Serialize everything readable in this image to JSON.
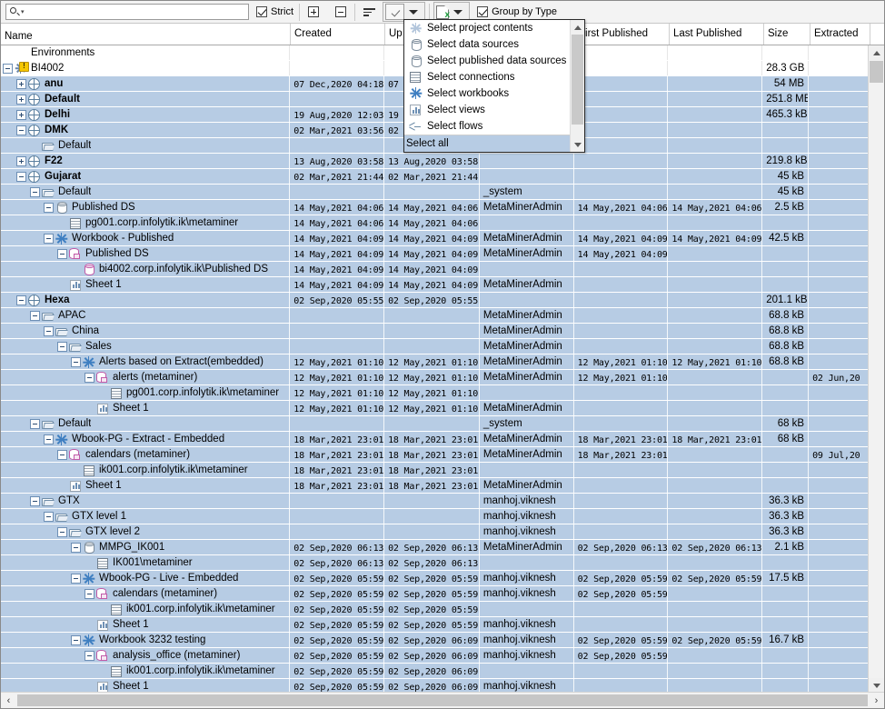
{
  "toolbar": {
    "search_placeholder": "",
    "search_value": "",
    "strict_label": "Strict",
    "strict_checked": true,
    "expand_all_title": "Expand all",
    "collapse_all_title": "Collapse all",
    "sort_title": "Sort",
    "select_combo_title": "Selection",
    "export_title": "Export",
    "group_by_type_label": "Group by Type",
    "group_by_type_checked": true
  },
  "menu": {
    "items": [
      {
        "label": "Select project contents",
        "icon": "project-contents-icon"
      },
      {
        "label": "Select data sources",
        "icon": "data-source-icon"
      },
      {
        "label": "Select published data sources",
        "icon": "published-data-source-icon"
      },
      {
        "label": "Select connections",
        "icon": "connection-icon"
      },
      {
        "label": "Select workbooks",
        "icon": "workbook-icon"
      },
      {
        "label": "Select views",
        "icon": "view-icon"
      },
      {
        "label": "Select flows",
        "icon": "flow-icon"
      }
    ],
    "footer": {
      "label": "Select all",
      "selected": true
    }
  },
  "grid": {
    "columns": [
      {
        "key": "name",
        "label": "Name"
      },
      {
        "key": "created",
        "label": "Created"
      },
      {
        "key": "updated",
        "label": "Up"
      },
      {
        "key": "owner",
        "label": ""
      },
      {
        "key": "first_published",
        "label": "First Published"
      },
      {
        "key": "last_published",
        "label": "Last Published"
      },
      {
        "key": "size",
        "label": "Size"
      },
      {
        "key": "extracted",
        "label": "Extracted"
      }
    ],
    "rows": [
      {
        "indent": 0,
        "twisty": "none",
        "icon": "none",
        "name": "Environments",
        "bold": false,
        "selected": false,
        "created": "",
        "updated": "",
        "owner": "",
        "first": "",
        "last": "",
        "size": "",
        "extracted": ""
      },
      {
        "indent": 0,
        "twisty": "minus",
        "icon": "server-warning-icon",
        "name": "BI4002",
        "bold": false,
        "selected": false,
        "created": "",
        "updated": "",
        "owner": "",
        "first": "",
        "last": "",
        "size": "28.3 GB",
        "extracted": ""
      },
      {
        "indent": 1,
        "twisty": "plus",
        "icon": "site-icon",
        "name": "anu",
        "bold": true,
        "selected": true,
        "created": "07 Dec,2020  04:18",
        "updated": "07",
        "owner": "",
        "first": "",
        "last": "",
        "size": "54 MB",
        "extracted": ""
      },
      {
        "indent": 1,
        "twisty": "plus",
        "icon": "site-icon",
        "name": "Default",
        "bold": true,
        "selected": true,
        "created": "",
        "updated": "",
        "owner": "",
        "first": "",
        "last": "",
        "size": "251.8 MB",
        "extracted": ""
      },
      {
        "indent": 1,
        "twisty": "plus",
        "icon": "site-icon",
        "name": "Delhi",
        "bold": true,
        "selected": true,
        "created": "19 Aug,2020  12:03",
        "updated": "19",
        "owner": "",
        "first": "",
        "last": "",
        "size": "465.3 kB",
        "extracted": ""
      },
      {
        "indent": 1,
        "twisty": "minus",
        "icon": "site-icon",
        "name": "DMK",
        "bold": true,
        "selected": true,
        "created": "02 Mar,2021  03:56",
        "updated": "02",
        "owner": "",
        "first": "",
        "last": "",
        "size": "",
        "extracted": ""
      },
      {
        "indent": 2,
        "twisty": "none",
        "icon": "folder-icon",
        "name": "Default",
        "bold": false,
        "selected": true,
        "created": "",
        "updated": "",
        "owner": "",
        "first": "",
        "last": "",
        "size": "",
        "extracted": ""
      },
      {
        "indent": 1,
        "twisty": "plus",
        "icon": "site-icon",
        "name": "F22",
        "bold": true,
        "selected": true,
        "created": "13 Aug,2020  03:58",
        "updated": "13 Aug,2020  03:58",
        "owner": "",
        "first": "",
        "last": "",
        "size": "219.8 kB",
        "extracted": ""
      },
      {
        "indent": 1,
        "twisty": "minus",
        "icon": "site-icon",
        "name": "Gujarat",
        "bold": true,
        "selected": true,
        "created": "02 Mar,2021  21:44",
        "updated": "02 Mar,2021  21:44",
        "owner": "",
        "first": "",
        "last": "",
        "size": "45 kB",
        "extracted": ""
      },
      {
        "indent": 2,
        "twisty": "minus",
        "icon": "folder-icon",
        "name": "Default",
        "bold": false,
        "selected": true,
        "created": "",
        "updated": "",
        "owner": "_system",
        "first": "",
        "last": "",
        "size": "45 kB",
        "extracted": ""
      },
      {
        "indent": 3,
        "twisty": "minus",
        "icon": "data-source-icon",
        "name": "Published DS",
        "bold": false,
        "selected": true,
        "created": "14 May,2021  04:06",
        "updated": "14 May,2021  04:06",
        "owner": "MetaMinerAdmin",
        "first": "14 May,2021  04:06",
        "last": "14 May,2021  04:06",
        "size": "2.5 kB",
        "extracted": ""
      },
      {
        "indent": 4,
        "twisty": "none",
        "icon": "connection-icon",
        "name": "pg001.corp.infolytik.ik\\metaminer",
        "bold": false,
        "selected": true,
        "created": "14 May,2021  04:06",
        "updated": "14 May,2021  04:06",
        "owner": "",
        "first": "",
        "last": "",
        "size": "",
        "extracted": ""
      },
      {
        "indent": 3,
        "twisty": "minus",
        "icon": "workbook-icon",
        "name": "Workbook - Published",
        "bold": false,
        "selected": true,
        "created": "14 May,2021  04:09",
        "updated": "14 May,2021  04:09",
        "owner": "MetaMinerAdmin",
        "first": "14 May,2021  04:09",
        "last": "14 May,2021  04:09",
        "size": "42.5 kB",
        "extracted": ""
      },
      {
        "indent": 4,
        "twisty": "minus",
        "icon": "embedded-ds-icon",
        "name": "Published DS",
        "bold": false,
        "selected": true,
        "created": "14 May,2021  04:09",
        "updated": "14 May,2021  04:09",
        "owner": "MetaMinerAdmin",
        "first": "14 May,2021  04:09",
        "last": "",
        "size": "",
        "extracted": ""
      },
      {
        "indent": 5,
        "twisty": "none",
        "icon": "published-data-source-icon",
        "name": "bi4002.corp.infolytik.ik\\Published DS",
        "bold": false,
        "selected": true,
        "created": "14 May,2021  04:09",
        "updated": "14 May,2021  04:09",
        "owner": "",
        "first": "",
        "last": "",
        "size": "",
        "extracted": ""
      },
      {
        "indent": 4,
        "twisty": "none",
        "icon": "view-icon",
        "name": "Sheet 1",
        "bold": false,
        "selected": true,
        "created": "14 May,2021  04:09",
        "updated": "14 May,2021  04:09",
        "owner": "MetaMinerAdmin",
        "first": "",
        "last": "",
        "size": "",
        "extracted": ""
      },
      {
        "indent": 1,
        "twisty": "minus",
        "icon": "site-icon",
        "name": "Hexa",
        "bold": true,
        "selected": true,
        "created": "02 Sep,2020  05:55",
        "updated": "02 Sep,2020  05:55",
        "owner": "",
        "first": "",
        "last": "",
        "size": "201.1 kB",
        "extracted": ""
      },
      {
        "indent": 2,
        "twisty": "minus",
        "icon": "folder-icon",
        "name": "APAC",
        "bold": false,
        "selected": true,
        "created": "",
        "updated": "",
        "owner": "MetaMinerAdmin",
        "first": "",
        "last": "",
        "size": "68.8 kB",
        "extracted": ""
      },
      {
        "indent": 3,
        "twisty": "minus",
        "icon": "folder-icon",
        "name": "China",
        "bold": false,
        "selected": true,
        "created": "",
        "updated": "",
        "owner": "MetaMinerAdmin",
        "first": "",
        "last": "",
        "size": "68.8 kB",
        "extracted": ""
      },
      {
        "indent": 4,
        "twisty": "minus",
        "icon": "folder-icon",
        "name": "Sales",
        "bold": false,
        "selected": true,
        "created": "",
        "updated": "",
        "owner": "MetaMinerAdmin",
        "first": "",
        "last": "",
        "size": "68.8 kB",
        "extracted": ""
      },
      {
        "indent": 5,
        "twisty": "minus",
        "icon": "workbook-icon",
        "name": "Alerts based on Extract(embedded)",
        "bold": false,
        "selected": true,
        "created": "12 May,2021  01:10",
        "updated": "12 May,2021  01:10",
        "owner": "MetaMinerAdmin",
        "first": "12 May,2021  01:10",
        "last": "12 May,2021  01:10",
        "size": "68.8 kB",
        "extracted": ""
      },
      {
        "indent": 6,
        "twisty": "minus",
        "icon": "embedded-ds-icon",
        "name": "alerts (metaminer)",
        "bold": false,
        "selected": true,
        "created": "12 May,2021  01:10",
        "updated": "12 May,2021  01:10",
        "owner": "MetaMinerAdmin",
        "first": "12 May,2021  01:10",
        "last": "",
        "size": "",
        "extracted": "02 Jun,20"
      },
      {
        "indent": 7,
        "twisty": "none",
        "icon": "connection-icon",
        "name": "pg001.corp.infolytik.ik\\metaminer",
        "bold": false,
        "selected": true,
        "created": "12 May,2021  01:10",
        "updated": "12 May,2021  01:10",
        "owner": "",
        "first": "",
        "last": "",
        "size": "",
        "extracted": ""
      },
      {
        "indent": 6,
        "twisty": "none",
        "icon": "view-icon",
        "name": "Sheet 1",
        "bold": false,
        "selected": true,
        "created": "12 May,2021  01:10",
        "updated": "12 May,2021  01:10",
        "owner": "MetaMinerAdmin",
        "first": "",
        "last": "",
        "size": "",
        "extracted": ""
      },
      {
        "indent": 2,
        "twisty": "minus",
        "icon": "folder-icon",
        "name": "Default",
        "bold": false,
        "selected": true,
        "created": "",
        "updated": "",
        "owner": "_system",
        "first": "",
        "last": "",
        "size": "68 kB",
        "extracted": ""
      },
      {
        "indent": 3,
        "twisty": "minus",
        "icon": "workbook-icon",
        "name": "Wbook-PG - Extract - Embedded",
        "bold": false,
        "selected": true,
        "created": "18 Mar,2021  23:01",
        "updated": "18 Mar,2021  23:01",
        "owner": "MetaMinerAdmin",
        "first": "18 Mar,2021  23:01",
        "last": "18 Mar,2021  23:01",
        "size": "68 kB",
        "extracted": ""
      },
      {
        "indent": 4,
        "twisty": "minus",
        "icon": "embedded-ds-icon",
        "name": "calendars (metaminer)",
        "bold": false,
        "selected": true,
        "created": "18 Mar,2021  23:01",
        "updated": "18 Mar,2021  23:01",
        "owner": "MetaMinerAdmin",
        "first": "18 Mar,2021  23:01",
        "last": "",
        "size": "",
        "extracted": "09 Jul,20"
      },
      {
        "indent": 5,
        "twisty": "none",
        "icon": "connection-icon",
        "name": "ik001.corp.infolytik.ik\\metaminer",
        "bold": false,
        "selected": true,
        "created": "18 Mar,2021  23:01",
        "updated": "18 Mar,2021  23:01",
        "owner": "",
        "first": "",
        "last": "",
        "size": "",
        "extracted": ""
      },
      {
        "indent": 4,
        "twisty": "none",
        "icon": "view-icon",
        "name": "Sheet 1",
        "bold": false,
        "selected": true,
        "created": "18 Mar,2021  23:01",
        "updated": "18 Mar,2021  23:01",
        "owner": "MetaMinerAdmin",
        "first": "",
        "last": "",
        "size": "",
        "extracted": ""
      },
      {
        "indent": 2,
        "twisty": "minus",
        "icon": "folder-icon",
        "name": "GTX",
        "bold": false,
        "selected": true,
        "created": "",
        "updated": "",
        "owner": "manhoj.viknesh",
        "first": "",
        "last": "",
        "size": "36.3 kB",
        "extracted": ""
      },
      {
        "indent": 3,
        "twisty": "minus",
        "icon": "folder-icon",
        "name": "GTX level 1",
        "bold": false,
        "selected": true,
        "created": "",
        "updated": "",
        "owner": "manhoj.viknesh",
        "first": "",
        "last": "",
        "size": "36.3 kB",
        "extracted": ""
      },
      {
        "indent": 4,
        "twisty": "minus",
        "icon": "folder-icon",
        "name": "GTX  level 2",
        "bold": false,
        "selected": true,
        "created": "",
        "updated": "",
        "owner": "manhoj.viknesh",
        "first": "",
        "last": "",
        "size": "36.3 kB",
        "extracted": ""
      },
      {
        "indent": 5,
        "twisty": "minus",
        "icon": "data-source-icon",
        "name": "MMPG_IK001",
        "bold": false,
        "selected": true,
        "created": "02 Sep,2020  06:13",
        "updated": "02 Sep,2020  06:13",
        "owner": "MetaMinerAdmin",
        "first": "02 Sep,2020  06:13",
        "last": "02 Sep,2020  06:13",
        "size": "2.1 kB",
        "extracted": ""
      },
      {
        "indent": 6,
        "twisty": "none",
        "icon": "connection-icon",
        "name": "IK001\\metaminer",
        "bold": false,
        "selected": true,
        "created": "02 Sep,2020  06:13",
        "updated": "02 Sep,2020  06:13",
        "owner": "",
        "first": "",
        "last": "",
        "size": "",
        "extracted": ""
      },
      {
        "indent": 5,
        "twisty": "minus",
        "icon": "workbook-icon",
        "name": "Wbook-PG - Live - Embedded",
        "bold": false,
        "selected": true,
        "created": "02 Sep,2020  05:59",
        "updated": "02 Sep,2020  05:59",
        "owner": "manhoj.viknesh",
        "first": "02 Sep,2020  05:59",
        "last": "02 Sep,2020  05:59",
        "size": "17.5 kB",
        "extracted": ""
      },
      {
        "indent": 6,
        "twisty": "minus",
        "icon": "embedded-ds-icon",
        "name": "calendars (metaminer)",
        "bold": false,
        "selected": true,
        "created": "02 Sep,2020  05:59",
        "updated": "02 Sep,2020  05:59",
        "owner": "manhoj.viknesh",
        "first": "02 Sep,2020  05:59",
        "last": "",
        "size": "",
        "extracted": ""
      },
      {
        "indent": 7,
        "twisty": "none",
        "icon": "connection-icon",
        "name": "ik001.corp.infolytik.ik\\metaminer",
        "bold": false,
        "selected": true,
        "created": "02 Sep,2020  05:59",
        "updated": "02 Sep,2020  05:59",
        "owner": "",
        "first": "",
        "last": "",
        "size": "",
        "extracted": ""
      },
      {
        "indent": 6,
        "twisty": "none",
        "icon": "view-icon",
        "name": "Sheet 1",
        "bold": false,
        "selected": true,
        "created": "02 Sep,2020  05:59",
        "updated": "02 Sep,2020  05:59",
        "owner": "manhoj.viknesh",
        "first": "",
        "last": "",
        "size": "",
        "extracted": ""
      },
      {
        "indent": 5,
        "twisty": "minus",
        "icon": "workbook-icon",
        "name": "Workbook 3232 testing",
        "bold": false,
        "selected": true,
        "created": "02 Sep,2020  05:59",
        "updated": "02 Sep,2020  06:09",
        "owner": "manhoj.viknesh",
        "first": "02 Sep,2020  05:59",
        "last": "02 Sep,2020  05:59",
        "size": "16.7 kB",
        "extracted": ""
      },
      {
        "indent": 6,
        "twisty": "minus",
        "icon": "embedded-ds-icon",
        "name": "analysis_office (metaminer)",
        "bold": false,
        "selected": true,
        "created": "02 Sep,2020  05:59",
        "updated": "02 Sep,2020  06:09",
        "owner": "manhoj.viknesh",
        "first": "02 Sep,2020  05:59",
        "last": "",
        "size": "",
        "extracted": ""
      },
      {
        "indent": 7,
        "twisty": "none",
        "icon": "connection-icon",
        "name": "ik001.corp.infolytik.ik\\metaminer",
        "bold": false,
        "selected": true,
        "created": "02 Sep,2020  05:59",
        "updated": "02 Sep,2020  06:09",
        "owner": "",
        "first": "",
        "last": "",
        "size": "",
        "extracted": ""
      },
      {
        "indent": 6,
        "twisty": "none",
        "icon": "view-icon",
        "name": "Sheet 1",
        "bold": false,
        "selected": true,
        "created": "02 Sep,2020  05:59",
        "updated": "02 Sep,2020  06:09",
        "owner": "manhoj.viknesh",
        "first": "",
        "last": "",
        "size": "",
        "extracted": ""
      }
    ]
  },
  "scrollbars": {
    "left_arrow": "‹",
    "right_arrow": "›"
  }
}
